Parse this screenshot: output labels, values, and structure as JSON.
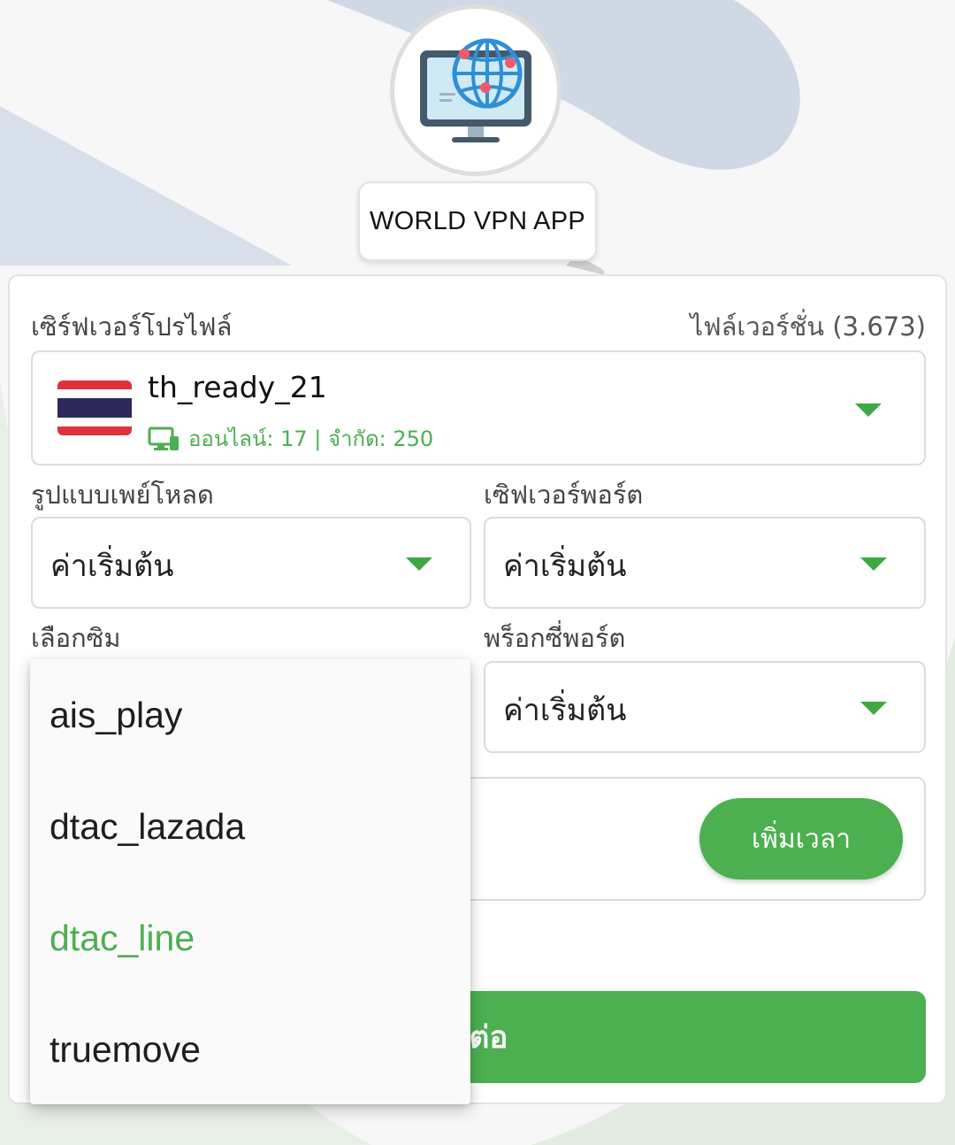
{
  "app": {
    "name": "WORLD VPN APP"
  },
  "colors": {
    "accent": "#4caf50",
    "card_border": "#dcdcdc",
    "background": "#f7f7f7"
  },
  "profile": {
    "label": "เซิร์ฟเวอร์โปรไฟล์",
    "file_version_label": "ไฟล์เวอร์ชั่น (3.673)"
  },
  "server": {
    "flag": "thailand-flag",
    "name": "th_ready_21",
    "stats": "ออนไลน์: 17 | จำกัด: 250",
    "status_icon": "monitor-icon"
  },
  "payload": {
    "label": "รูปแบบเพย์โหลด",
    "value": "ค่าเริ่มต้น"
  },
  "server_port": {
    "label": "เซิฟเวอร์พอร์ต",
    "value": "ค่าเริ่มต้น"
  },
  "sim": {
    "label": "เลือกซิม"
  },
  "proxy_port": {
    "label": "พร็อกซี่พอร์ต",
    "value": "ค่าเริ่มต้น"
  },
  "time_panel": {
    "partial_text": "์",
    "add_time_label": "เพิ่มเวลา"
  },
  "connect": {
    "label_visible": "มต่อ"
  },
  "sim_menu": {
    "options": [
      {
        "label": "ais_play",
        "selected": false
      },
      {
        "label": "dtac_lazada",
        "selected": false
      },
      {
        "label": "dtac_line",
        "selected": true
      },
      {
        "label": "truemove",
        "selected": false
      }
    ]
  }
}
